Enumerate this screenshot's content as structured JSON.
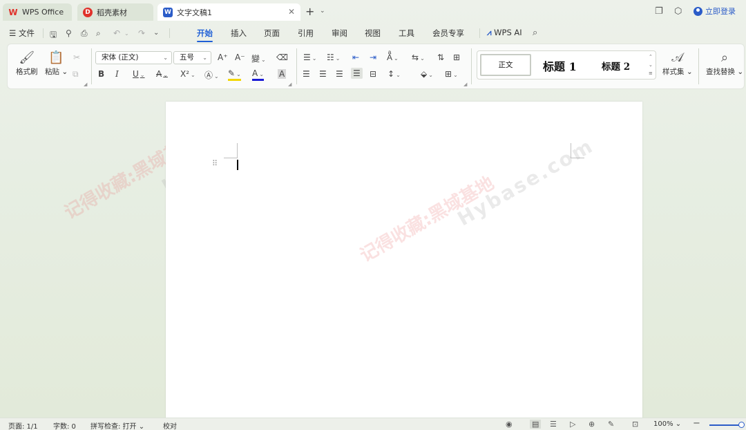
{
  "tabs": [
    {
      "label": "WPS Office",
      "icon": "wps-logo-icon",
      "color": "#e0322b"
    },
    {
      "label": "稻壳素材",
      "icon": "docer-icon",
      "color": "#e0322b"
    },
    {
      "label": "文字文稿1",
      "icon": "word-doc-icon",
      "color": "#2b5cc8"
    }
  ],
  "login": {
    "label": "立即登录"
  },
  "menu": {
    "file": "文件",
    "tabs": [
      "开始",
      "插入",
      "页面",
      "引用",
      "审阅",
      "视图",
      "工具",
      "会员专享"
    ],
    "ai": "WPS AI"
  },
  "ribbon": {
    "format_painter": "格式刷",
    "paste": "粘贴",
    "font_name": "宋体 (正文)",
    "font_size": "五号",
    "styles": {
      "normal": "正文",
      "h1": "标题  1",
      "h2": "标题  2"
    },
    "style_set": "样式集",
    "find_replace": "查找替换"
  },
  "watermarks": {
    "cn": "记得收藏:黑域基地",
    "en": "Hybase.com"
  },
  "status": {
    "page": "页面: 1/1",
    "words": "字数: 0",
    "spell": "拼写检查: 打开",
    "proof": "校对",
    "zoom": "100%"
  },
  "colors": {
    "accent": "#1f5fd6",
    "highlight": "#f2d600",
    "font_color": "#1a1ad6"
  }
}
